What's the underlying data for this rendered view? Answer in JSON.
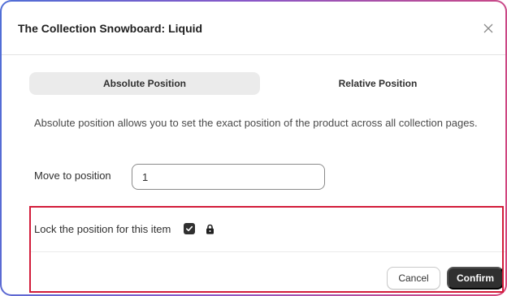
{
  "dialog": {
    "title": "The Collection Snowboard: Liquid",
    "close_icon": "close-icon"
  },
  "tabs": [
    {
      "label": "Absolute Position",
      "active": true
    },
    {
      "label": "Relative Position",
      "active": false
    }
  ],
  "description": "Absolute position allows you to set the exact position of the product across all collection pages.",
  "move": {
    "label": "Move to position",
    "value": "1"
  },
  "lock": {
    "label": "Lock the position for this item",
    "checked": true,
    "icon": "lock-icon"
  },
  "footer": {
    "cancel_label": "Cancel",
    "confirm_label": "Confirm"
  },
  "colors": {
    "highlight": "#d21c3a",
    "primary_button": "#303030",
    "active_tab": "#ebebeb"
  }
}
